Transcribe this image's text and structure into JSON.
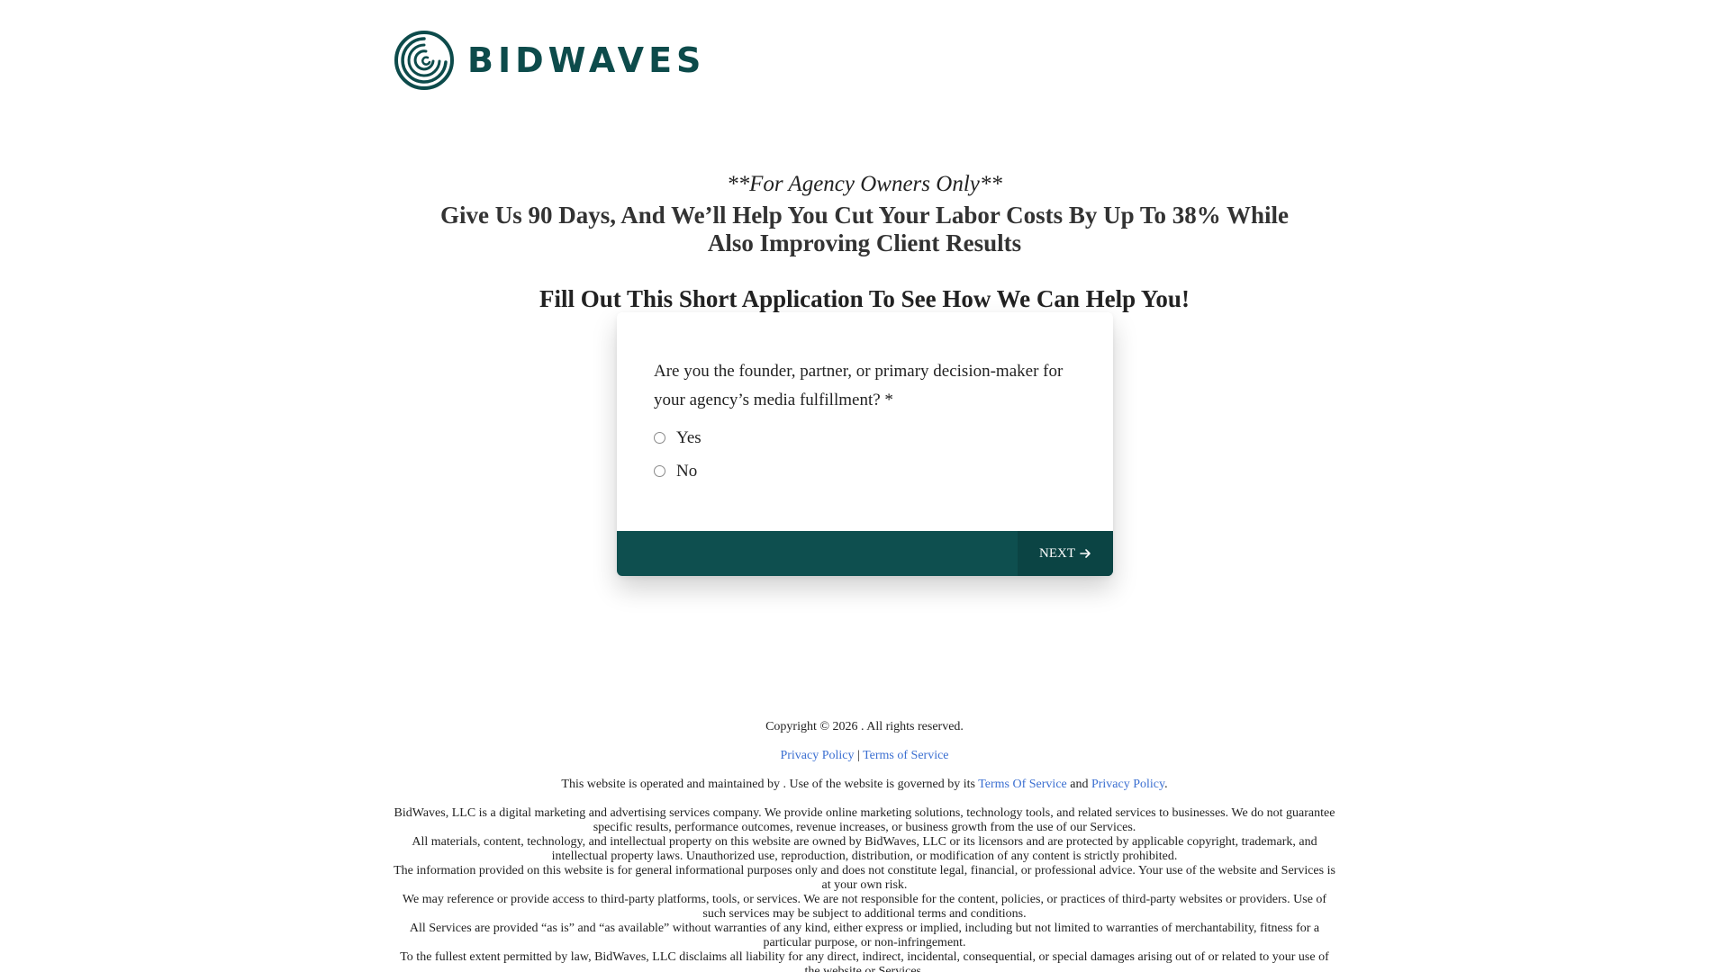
{
  "brand": {
    "name": "BIDWAVES",
    "color": "#0d4b4b"
  },
  "hero": {
    "eyebrow": "**For Agency Owners Only**",
    "headline": "Give Us 90 Days, And We’ll Help You Cut Your Labor Costs By Up To 38% While Also Improving Client Results",
    "subheadline": "Fill Out This Short Application To See How We Can Help You!"
  },
  "form": {
    "question": "Are you the founder, partner, or primary decision-maker for your agency’s media fulfillment? *",
    "options": [
      {
        "label": "Yes",
        "selected": false
      },
      {
        "label": "No",
        "selected": false
      }
    ],
    "next_label": "NEXT",
    "footer_color": "#0e4f4f"
  },
  "footer": {
    "copyright": "Copyright © 2026 . All rights reserved.",
    "links": {
      "privacy": "Privacy Policy",
      "separator": "|",
      "terms": "Terms of Service"
    },
    "governed": {
      "prefix": "This website is operated and maintained by . Use of the website is governed by its",
      "terms_link": "Terms Of Service",
      "and": "and",
      "privacy_link": "Privacy Policy",
      "suffix": "."
    },
    "legal": [
      "BidWaves, LLC is a digital marketing and advertising services company. We provide online marketing solutions, technology tools, and related services to businesses. We do not guarantee specific results, performance outcomes, revenue increases, or business growth from the use of our Services.",
      "All materials, content, technology, and intellectual property on this website are owned by BidWaves, LLC or its licensors and are protected by applicable copyright, trademark, and intellectual property laws. Unauthorized use, reproduction, distribution, or modification of any content is strictly prohibited.",
      "The information provided on this website is for general informational purposes only and does not constitute legal, financial, or professional advice. Your use of the website and Services is at your own risk.",
      "We may reference or provide access to third-party platforms, tools, or services. We are not responsible for the content, policies, or practices of third-party websites or providers. Use of such services may be subject to additional terms and conditions.",
      "All Services are provided “as is” and “as available” without warranties of any kind, either express or implied, including but not limited to warranties of merchantability, fitness for a particular purpose, or non-infringement.",
      "To the fullest extent permitted by law, BidWaves, LLC disclaims all liability for any direct, indirect, incidental, consequential, or special damages arising out of or related to your use of the website or Services."
    ]
  }
}
